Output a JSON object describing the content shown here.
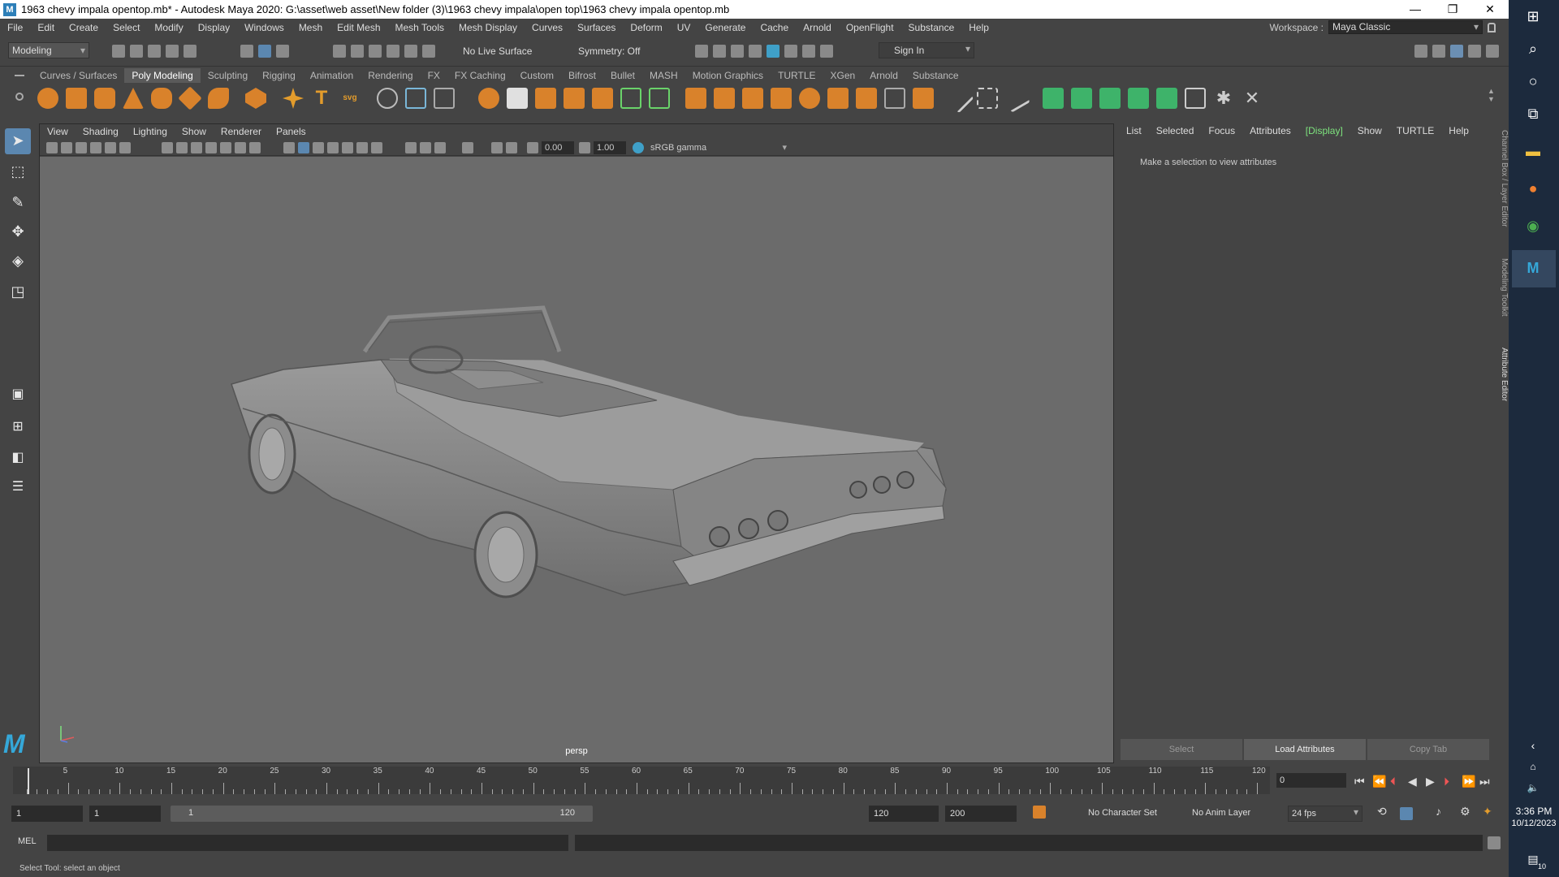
{
  "window": {
    "title": "1963 chevy impala opentop.mb* - Autodesk Maya 2020: G:\\asset\\web asset\\New folder (3)\\1963 chevy impala\\open top\\1963 chevy impala opentop.mb",
    "app_icon": "M"
  },
  "menubar": {
    "items": [
      "File",
      "Edit",
      "Create",
      "Select",
      "Modify",
      "Display",
      "Windows",
      "Mesh",
      "Edit Mesh",
      "Mesh Tools",
      "Mesh Display",
      "Curves",
      "Surfaces",
      "Deform",
      "UV",
      "Generate",
      "Cache",
      "Arnold",
      "OpenFlight",
      "Substance",
      "Help"
    ],
    "workspace_label": "Workspace :",
    "workspace_value": "Maya Classic"
  },
  "statusline": {
    "mode": "Modeling",
    "live_surface": "No Live Surface",
    "symmetry": "Symmetry: Off",
    "sign_in": "Sign In"
  },
  "shelf": {
    "tabs": [
      "Curves / Surfaces",
      "Poly Modeling",
      "Sculpting",
      "Rigging",
      "Animation",
      "Rendering",
      "FX",
      "FX Caching",
      "Custom",
      "Bifrost",
      "Bullet",
      "MASH",
      "Motion Graphics",
      "TURTLE",
      "XGen",
      "Arnold",
      "Substance"
    ],
    "active_tab": "Poly Modeling"
  },
  "viewport": {
    "menu": [
      "View",
      "Shading",
      "Lighting",
      "Show",
      "Renderer",
      "Panels"
    ],
    "exposure": "0.00",
    "gamma": "1.00",
    "color_space": "sRGB gamma",
    "camera": "persp"
  },
  "attribute_editor": {
    "menu": [
      "List",
      "Selected",
      "Focus",
      "Attributes",
      "[Display]",
      "Show",
      "TURTLE",
      "Help"
    ],
    "message": "Make a selection to view attributes",
    "buttons": [
      "Select",
      "Load Attributes",
      "Copy Tab"
    ],
    "side_tabs": [
      "Channel Box / Layer Editor",
      "Modeling Toolkit",
      "Attribute Editor"
    ]
  },
  "timeline": {
    "ticks": [
      "5",
      "10",
      "15",
      "20",
      "25",
      "30",
      "35",
      "40",
      "45",
      "50",
      "55",
      "60",
      "65",
      "70",
      "75",
      "80",
      "85",
      "90",
      "95",
      "100",
      "105",
      "110",
      "115",
      "120"
    ],
    "current_frame": "0"
  },
  "range": {
    "start": "1",
    "anim_start": "1",
    "slider_start": "1",
    "slider_end": "120",
    "end": "120",
    "anim_end": "200",
    "character_set": "No Character Set",
    "anim_layer": "No Anim Layer",
    "fps": "24 fps"
  },
  "cmdline": {
    "label": "MEL",
    "help": "Select Tool: select an object"
  },
  "taskbar": {
    "time": "3:36 PM",
    "date": "10/12/2023",
    "notifications": "10"
  }
}
